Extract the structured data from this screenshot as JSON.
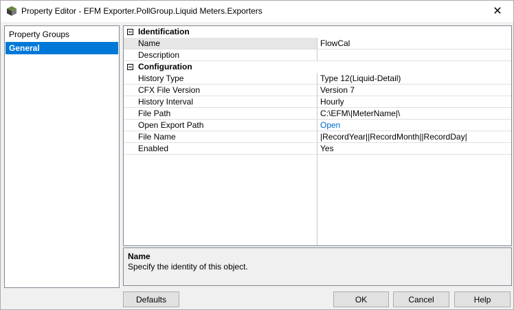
{
  "window": {
    "title": "Property Editor - EFM Exporter.PollGroup.Liquid Meters.Exporters",
    "close_glyph": "✕"
  },
  "left_panel": {
    "header": "Property Groups",
    "items": [
      {
        "label": "General",
        "selected": true
      }
    ]
  },
  "grid": {
    "categories": [
      {
        "label": "Identification",
        "rows": [
          {
            "name": "Name",
            "value": "FlowCal",
            "selected": true
          },
          {
            "name": "Description",
            "value": ""
          }
        ]
      },
      {
        "label": "Configuration",
        "rows": [
          {
            "name": "History Type",
            "value": "Type 12(Liquid-Detail)"
          },
          {
            "name": "CFX File Version",
            "value": "Version 7"
          },
          {
            "name": "History Interval",
            "value": "Hourly"
          },
          {
            "name": "File Path",
            "value": "C:\\EFM\\|MeterName|\\"
          },
          {
            "name": "Open Export Path",
            "value": "Open",
            "link": true
          },
          {
            "name": "File Name",
            "value": "|RecordYear||RecordMonth||RecordDay|"
          },
          {
            "name": "Enabled",
            "value": "Yes"
          }
        ]
      }
    ]
  },
  "description": {
    "title": "Name",
    "text": "Specify the identity of this object."
  },
  "buttons": {
    "defaults": "Defaults",
    "ok": "OK",
    "cancel": "Cancel",
    "help": "Help"
  },
  "colors": {
    "selection": "#0078d7",
    "link": "#0066cc"
  }
}
